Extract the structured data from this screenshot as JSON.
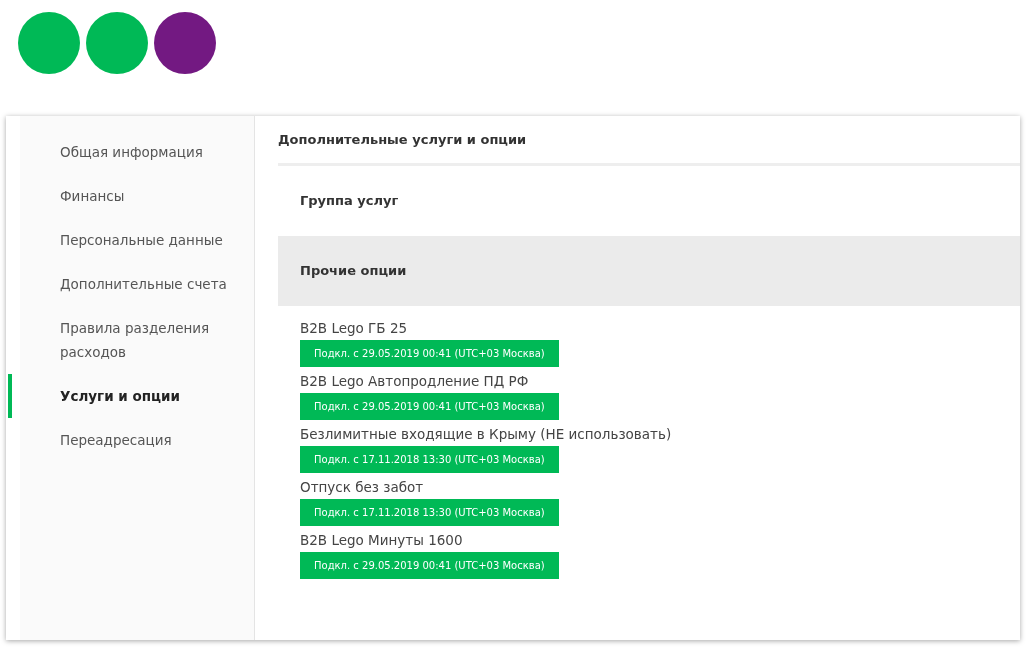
{
  "sidebar": {
    "items": [
      {
        "label": "Общая информация",
        "selected": false
      },
      {
        "label": "Финансы",
        "selected": false
      },
      {
        "label": "Персональные данные",
        "selected": false
      },
      {
        "label": "Дополнительные счета",
        "selected": false
      },
      {
        "label": "Правила разделения расходов",
        "selected": false
      },
      {
        "label": "Услуги и опции",
        "selected": true
      },
      {
        "label": "Переадресация",
        "selected": false
      }
    ]
  },
  "main": {
    "title": "Дополнительные услуги и опции",
    "groups": [
      {
        "label": "Группа услуг",
        "selected": false
      },
      {
        "label": "Прочие опции",
        "selected": true
      }
    ],
    "options": [
      {
        "name": "B2B Lego ГБ 25",
        "status": "Подкл. с 29.05.2019 00:41 (UTC+03 Москва)"
      },
      {
        "name": "B2B Lego Автопродление ПД РФ",
        "status": "Подкл. с 29.05.2019 00:41 (UTC+03 Москва)"
      },
      {
        "name": "Безлимитные входящие в Крыму (НЕ использовать)",
        "status": "Подкл. с 17.11.2018 13:30 (UTC+03 Москва)"
      },
      {
        "name": "Отпуск без забот",
        "status": "Подкл. с 17.11.2018 13:30 (UTC+03 Москва)"
      },
      {
        "name": "B2B Lego Минуты 1600",
        "status": "Подкл. с 29.05.2019 00:41 (UTC+03 Москва)"
      }
    ]
  }
}
